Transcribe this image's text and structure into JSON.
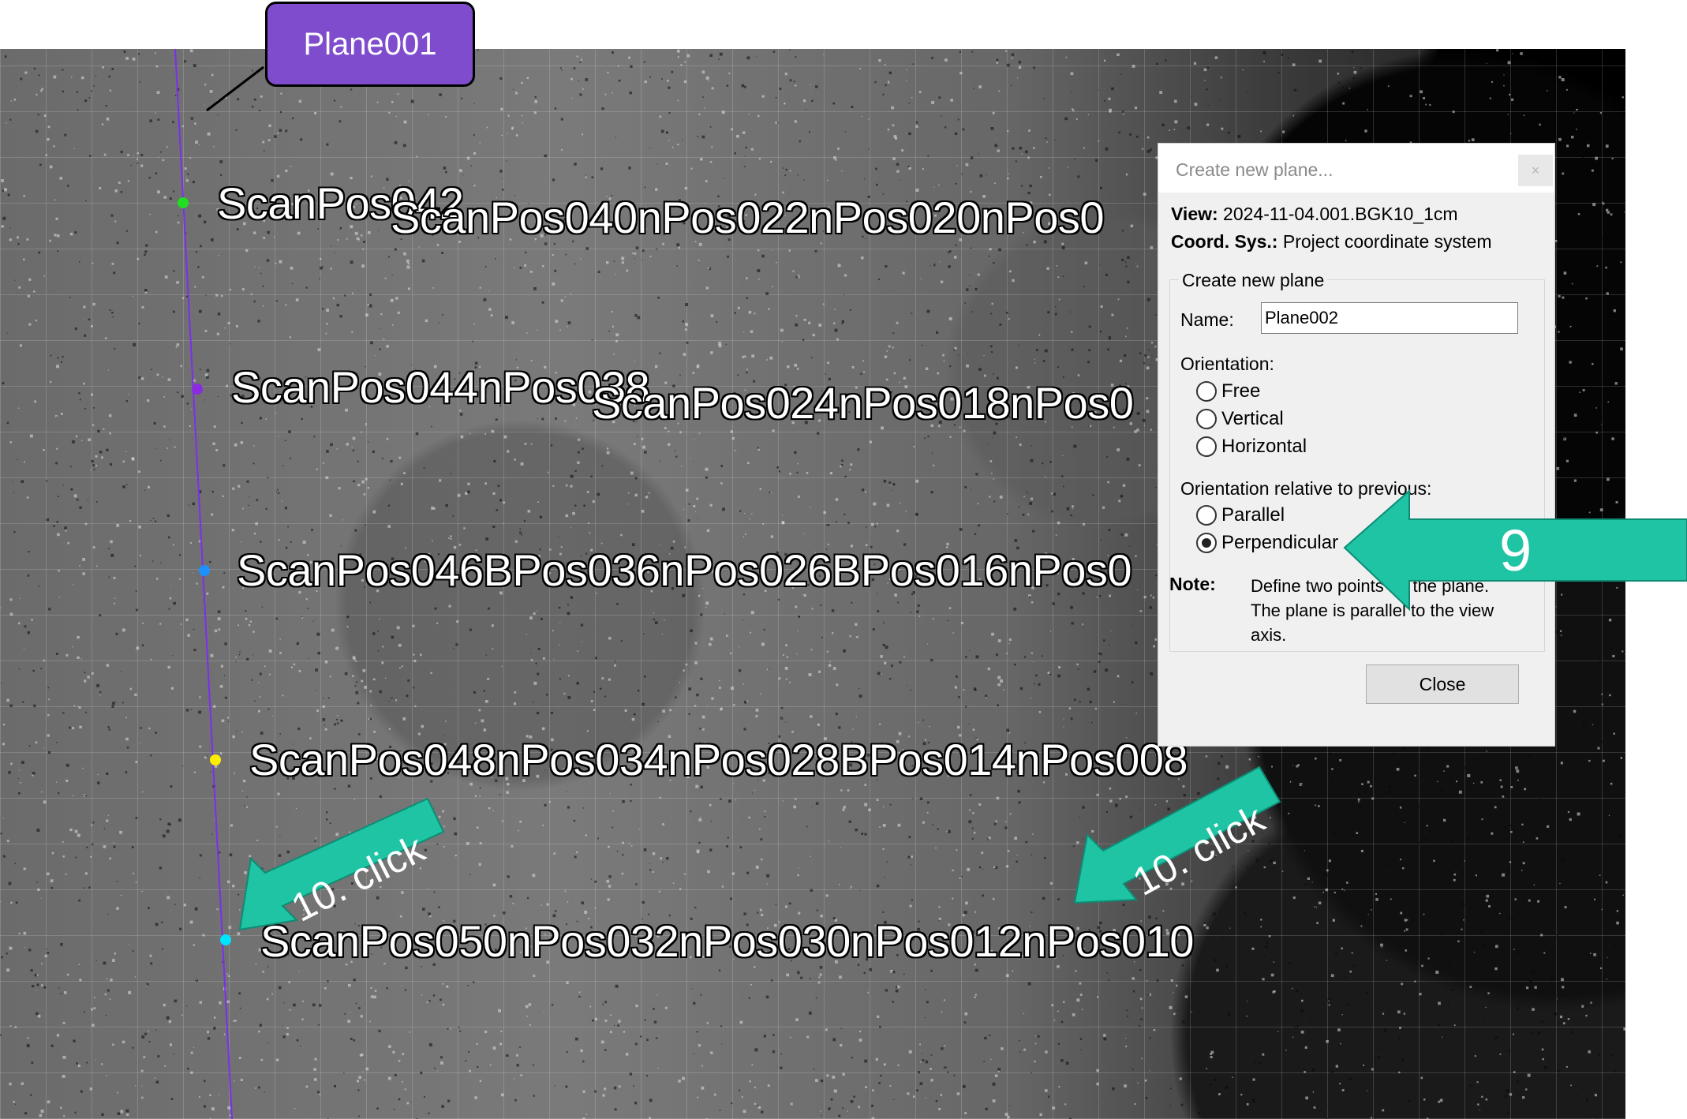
{
  "callout": {
    "label": "Plane001"
  },
  "scan_labels": [
    "ScanPos042",
    "ScanPos040nPos022nPos020nPos0",
    "ScanPos044nPos038",
    "ScanPos024nPos018nPos0",
    "ScanPos046BPos036nPos026BPos016nPos0",
    "ScanPos048nPos034nPos028BPos014nPos008",
    "ScanPos050nPos032nPos030nPos012nPos010"
  ],
  "dialog": {
    "title": "Create new plane...",
    "close_x": "×",
    "view_label": "View:",
    "view_value": "2024-11-04.001.BGK10_1cm",
    "coord_label": "Coord. Sys.:",
    "coord_value": "Project coordinate system",
    "group_title": "Create new plane",
    "name_label": "Name:",
    "name_value": "Plane002",
    "orientation_label": "Orientation:",
    "orientation_options": [
      "Free",
      "Vertical",
      "Horizontal"
    ],
    "relative_label": "Orientation relative to previous:",
    "relative_options": [
      "Parallel",
      "Perpendicular"
    ],
    "relative_selected": "Perpendicular",
    "note_label": "Note:",
    "note_text": "Define two points on the plane. The plane is parallel to the view axis.",
    "close_button": "Close"
  },
  "annotations": {
    "step9": "9",
    "click_left": "10. click",
    "click_right": "10. click",
    "accent_color": "#1fc4a4",
    "callout_color": "#7e4ccc"
  }
}
